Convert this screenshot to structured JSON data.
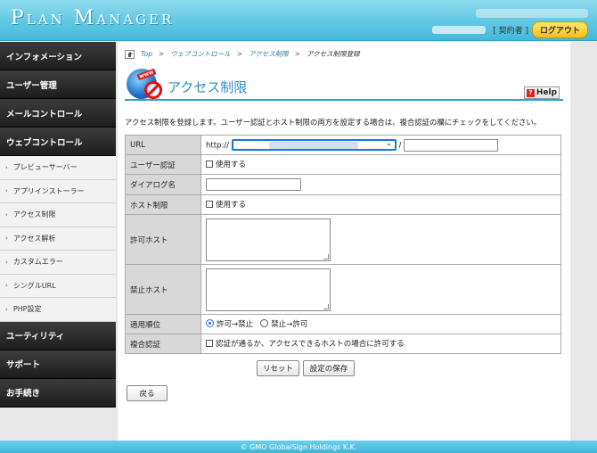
{
  "header": {
    "logo": "Plan Manager",
    "contractor_label": "[ 契約者 ]",
    "logout_label": "ログアウト"
  },
  "sidebar": {
    "items": [
      {
        "label": "インフォメーション",
        "type": "main"
      },
      {
        "label": "ユーザー管理",
        "type": "main"
      },
      {
        "label": "メールコントロール",
        "type": "main"
      },
      {
        "label": "ウェブコントロール",
        "type": "main"
      },
      {
        "label": "プレビューサーバー",
        "type": "sub"
      },
      {
        "label": "アプリインストーラー",
        "type": "sub"
      },
      {
        "label": "アクセス制限",
        "type": "sub"
      },
      {
        "label": "アクセス解析",
        "type": "sub"
      },
      {
        "label": "カスタムエラー",
        "type": "sub"
      },
      {
        "label": "シングルURL",
        "type": "sub"
      },
      {
        "label": "PHP設定",
        "type": "sub"
      },
      {
        "label": "ユーティリティ",
        "type": "main"
      },
      {
        "label": "サポート",
        "type": "main"
      },
      {
        "label": "お手続き",
        "type": "main"
      }
    ]
  },
  "breadcrumb": {
    "top": "Top",
    "web": "ウェブコントロール",
    "access": "アクセス制限",
    "current": "アクセス制限登録",
    "sep": ">"
  },
  "page": {
    "title": "アクセス制限",
    "help_label": "Help",
    "description": "アクセス制限を登録します。ユーザー認証とホスト制限の両方を設定する場合は、複合認証の欄にチェックをしてください。"
  },
  "form": {
    "url_label": "URL",
    "url_prefix": "http://",
    "url_slash": "/",
    "user_auth_label": "ユーザー認証",
    "user_auth_check": "使用する",
    "dialog_label": "ダイアログ名",
    "host_limit_label": "ホスト制限",
    "host_limit_check": "使用する",
    "allow_host_label": "許可ホスト",
    "deny_host_label": "禁止ホスト",
    "order_label": "適用順位",
    "order_opt1": "許可→禁止",
    "order_opt2": "禁止→許可",
    "combined_label": "複合認証",
    "combined_check": "認証が通るか、アクセスできるホストの場合に許可する"
  },
  "buttons": {
    "reset": "リセット",
    "save": "設定の保存",
    "back": "戻る"
  },
  "footer": {
    "text": "© GMO GlobalSign Holdings K.K."
  }
}
